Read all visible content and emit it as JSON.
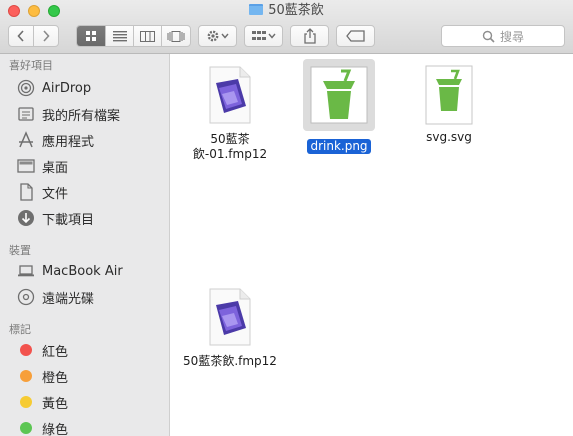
{
  "window": {
    "title": "50藍茶飲"
  },
  "toolbar": {
    "search_placeholder": "搜尋"
  },
  "sidebar": {
    "sections": [
      {
        "title": "喜好項目",
        "items": [
          {
            "label": "AirDrop",
            "icon": "airdrop-icon"
          },
          {
            "label": "我的所有檔案",
            "icon": "all-files-icon"
          },
          {
            "label": "應用程式",
            "icon": "applications-icon"
          },
          {
            "label": "桌面",
            "icon": "desktop-icon"
          },
          {
            "label": "文件",
            "icon": "documents-icon"
          },
          {
            "label": "下載項目",
            "icon": "downloads-icon"
          }
        ]
      },
      {
        "title": "裝置",
        "items": [
          {
            "label": "MacBook Air",
            "icon": "laptop-icon"
          },
          {
            "label": "遠端光碟",
            "icon": "remote-disc-icon"
          }
        ]
      },
      {
        "title": "標記",
        "items": [
          {
            "label": "紅色",
            "color": "#f2524d"
          },
          {
            "label": "橙色",
            "color": "#f79f3a"
          },
          {
            "label": "黃色",
            "color": "#f6cb33"
          },
          {
            "label": "綠色",
            "color": "#5cc653"
          }
        ]
      }
    ]
  },
  "files": [
    {
      "name_line1": "50藍茶",
      "name_line2": "飲-01.fmp12",
      "type": "filemaker",
      "selected": false
    },
    {
      "name": "drink.png",
      "type": "png",
      "selected": true
    },
    {
      "name": "svg.svg",
      "type": "svg",
      "selected": false
    },
    {
      "name": "50藍茶飲.fmp12",
      "type": "filemaker",
      "selected": false
    }
  ],
  "colors": {
    "accent": "#1a63d6",
    "drink_green": "#6ab946",
    "filemaker_purple": "#5a3fb8"
  }
}
